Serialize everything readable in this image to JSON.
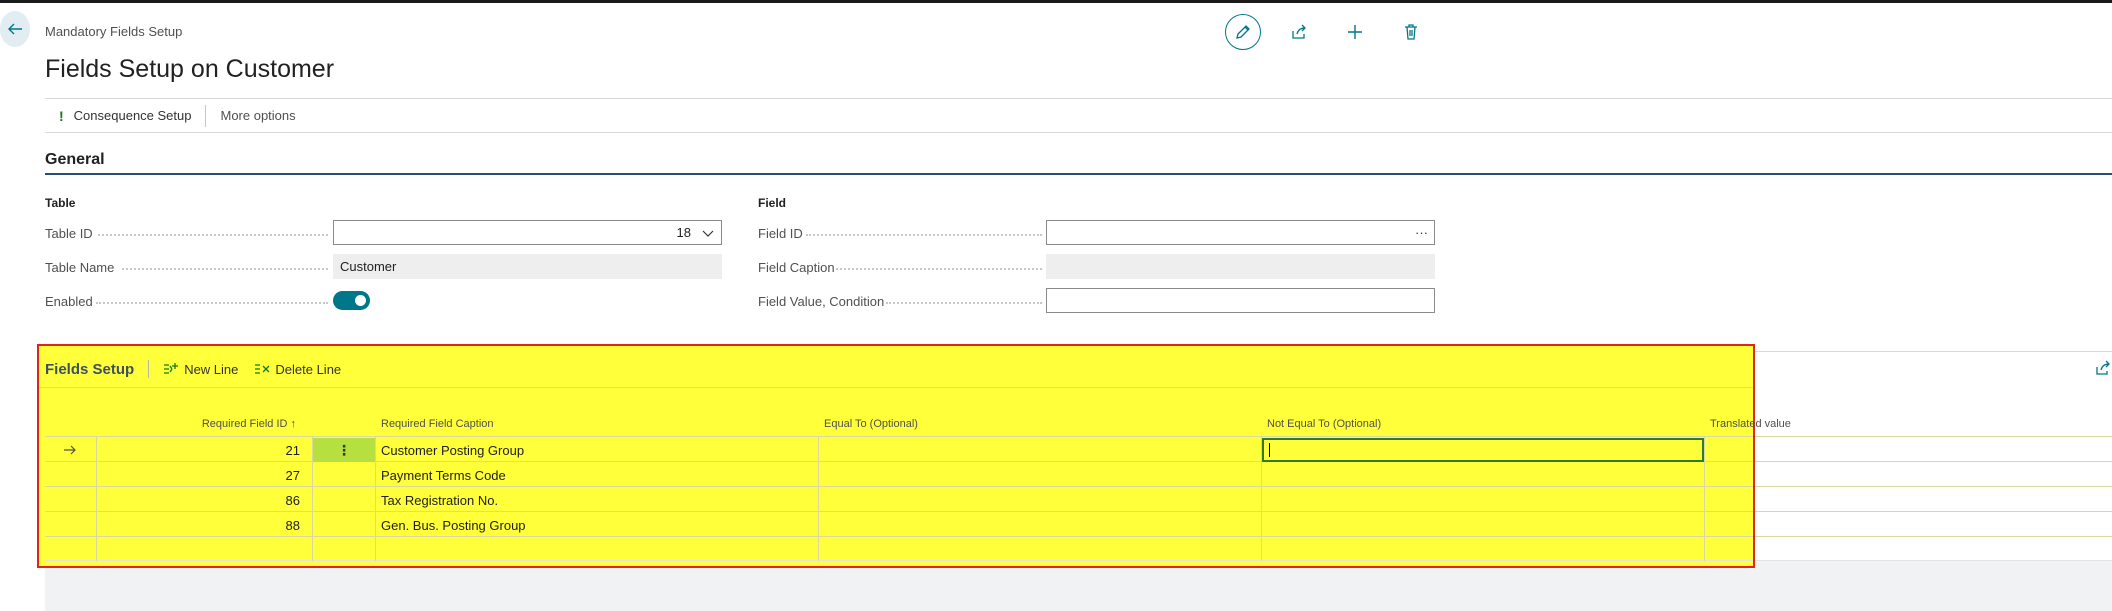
{
  "header": {
    "breadcrumb": "Mandatory Fields Setup",
    "title": "Fields Setup on Customer"
  },
  "actionbar": {
    "consequence_label": "Consequence Setup",
    "more_label": "More options"
  },
  "general": {
    "section_title": "General",
    "table_group": "Table",
    "field_group": "Field",
    "table_id_label": "Table ID",
    "table_id_value": "18",
    "table_name_label": "Table Name",
    "table_name_value": "Customer",
    "enabled_label": "Enabled",
    "enabled_value": true,
    "field_id_label": "Field ID",
    "field_id_value": "",
    "field_caption_label": "Field Caption",
    "field_caption_value": "",
    "field_condition_label": "Field Value, Condition",
    "field_condition_value": ""
  },
  "subpage": {
    "title": "Fields Setup",
    "new_line_label": "New Line",
    "delete_line_label": "Delete Line",
    "columns": {
      "required_field_id": "Required Field ID ↑",
      "required_field_caption": "Required Field Caption",
      "equal_to": "Equal To (Optional)",
      "not_equal_to": "Not Equal To (Optional)",
      "translated_value": "Translated value"
    },
    "rows": [
      {
        "id": "21",
        "caption": "Customer Posting Group"
      },
      {
        "id": "27",
        "caption": "Payment Terms Code"
      },
      {
        "id": "86",
        "caption": "Tax Registration No."
      },
      {
        "id": "88",
        "caption": "Gen. Bus. Posting Group"
      }
    ]
  },
  "colors": {
    "accent": "#00768a",
    "highlight": "#ffff3a",
    "frame": "#e2231a",
    "selected_row_marker": "#b5e040"
  }
}
